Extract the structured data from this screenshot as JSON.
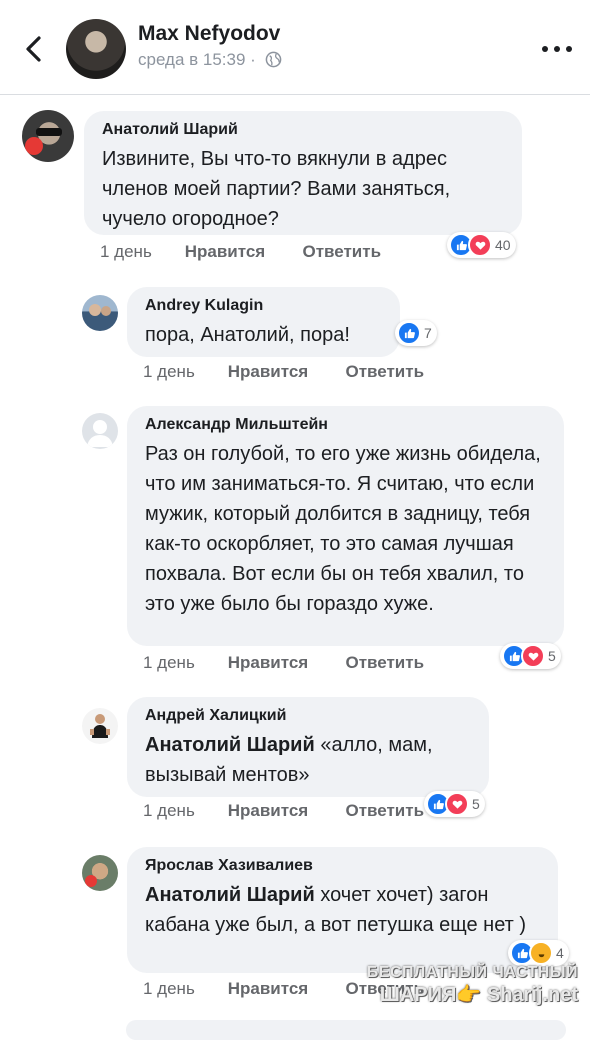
{
  "header": {
    "author": "Max Nefyodov",
    "time": "среда в 15:39 ·"
  },
  "comments": [
    {
      "author": "Анатолий Шарий",
      "text": "Извините, Вы что-то вякнули в адрес членов моей партии? Вами заняться, чучело огородное?",
      "time": "1 день",
      "like": "Нравится",
      "reply": "Ответить",
      "reaction_count": "40"
    },
    {
      "author": "Andrey Kulagin",
      "text": "пора, Анатолий, пора!",
      "time": "1 день",
      "like": "Нравится",
      "reply": "Ответить",
      "reaction_count": "7"
    },
    {
      "author": "Александр Мильштейн",
      "text": "Раз он голубой, то его уже жизнь обидела, что им заниматься-то. Я считаю, что если мужик, который долбится в задницу, тебя как-то оскорбляет, то это самая лучшая похвала. Вот если бы он тебя хвалил, то это уже было бы гораздо хуже.",
      "time": "1 день",
      "like": "Нравится",
      "reply": "Ответить",
      "reaction_count": "5"
    },
    {
      "author": "Андрей Халицкий",
      "mention": "Анатолий Шарий",
      "text": " «алло, мам, вызывай ментов»",
      "time": "1 день",
      "like": "Нравится",
      "reply": "Ответить",
      "reaction_count": "5"
    },
    {
      "author": "Ярослав Хазивалиев",
      "mention": "Анатолий Шарий",
      "text": " хочет хочет) загон кабана уже был, а вот петушка еще нет )",
      "time": "1 день",
      "like": "Нравится",
      "reply": "Ответить",
      "reaction_count": "4"
    }
  ],
  "watermark": {
    "line1": "БЕСПЛАТНЫЙ ЧАСТНЫЙ",
    "line2": "ШАРИЯ👉 Sharij.net"
  },
  "colors": {
    "like": "#1877f2",
    "love": "#f33e58",
    "bubble": "#f0f2f5"
  }
}
